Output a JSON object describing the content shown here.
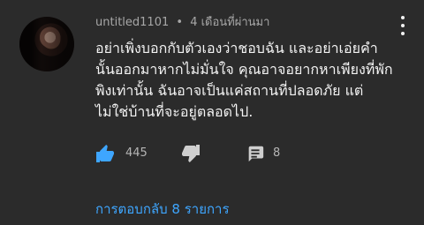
{
  "comment": {
    "author": "untitled1101",
    "separator": "•",
    "timestamp": "4 เดือนที่ผ่านมา",
    "text_lines": [
      "อย่าเพิ่งบอกกับตัวเองว่าชอบฉัน และอย่าเอ่ยคำ",
      "นั้นออกมาหากไม่มั่นใจ คุณอาจอยากหาเพียงที่พัก",
      "พิงเท่านั้น ฉันอาจเป็นแค่สถานที่ปลอดภัย แต่",
      "ไม่ใช่บ้านที่จะอยู่ตลอดไป."
    ],
    "like_count": "445",
    "reply_count": "8",
    "view_replies_label": "การตอบกลับ 8 รายการ"
  },
  "icons": {
    "like": "thumbs-up-icon",
    "dislike": "thumbs-down-icon",
    "reply": "reply-icon",
    "menu": "more-vert-icon"
  },
  "colors": {
    "background": "#2b2b2b",
    "text": "#f3f3f3",
    "muted": "#a7a7a7",
    "accent": "#3ea6ff"
  }
}
